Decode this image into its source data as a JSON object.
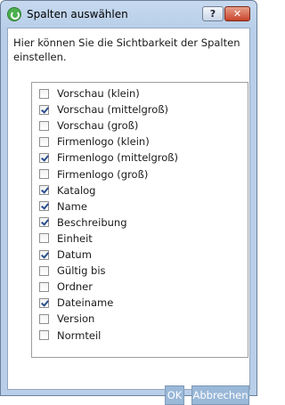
{
  "window": {
    "title": "Spalten auswählen"
  },
  "titlebar_buttons": {
    "help": "?",
    "close": "✕"
  },
  "instructions": "Hier können Sie die Sichtbarkeit der Spalten einstellen.",
  "columns": [
    {
      "label": "Vorschau (klein)",
      "checked": false
    },
    {
      "label": "Vorschau (mittelgroß)",
      "checked": true
    },
    {
      "label": "Vorschau (groß)",
      "checked": false
    },
    {
      "label": "Firmenlogo (klein)",
      "checked": false
    },
    {
      "label": "Firmenlogo (mittelgroß)",
      "checked": true
    },
    {
      "label": "Firmenlogo (groß)",
      "checked": false
    },
    {
      "label": "Katalog",
      "checked": true
    },
    {
      "label": "Name",
      "checked": true
    },
    {
      "label": "Beschreibung",
      "checked": true
    },
    {
      "label": "Einheit",
      "checked": false
    },
    {
      "label": "Datum",
      "checked": true
    },
    {
      "label": "Gültig bis",
      "checked": false
    },
    {
      "label": "Ordner",
      "checked": false
    },
    {
      "label": "Dateiname",
      "checked": true
    },
    {
      "label": "Version",
      "checked": false
    },
    {
      "label": "Normteil",
      "checked": false
    }
  ],
  "buttons": {
    "ok": "OK",
    "cancel": "Abbrechen"
  }
}
